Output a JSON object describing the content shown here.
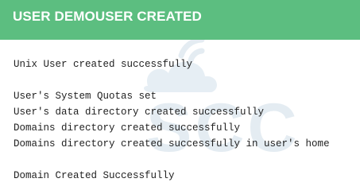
{
  "header": {
    "title": "USER DEMOUSER CREATED",
    "background_color": "#5cbe80"
  },
  "watermark": {
    "icon": "cloud-wifi-logo",
    "text": "SCCU"
  },
  "log": {
    "lines": [
      "Unix User created successfully",
      "",
      "User's System Quotas set",
      "User's data directory created successfully",
      "Domains directory created successfully",
      "Domains directory created successfully in user's home",
      "",
      "Domain Created Successfully"
    ]
  }
}
